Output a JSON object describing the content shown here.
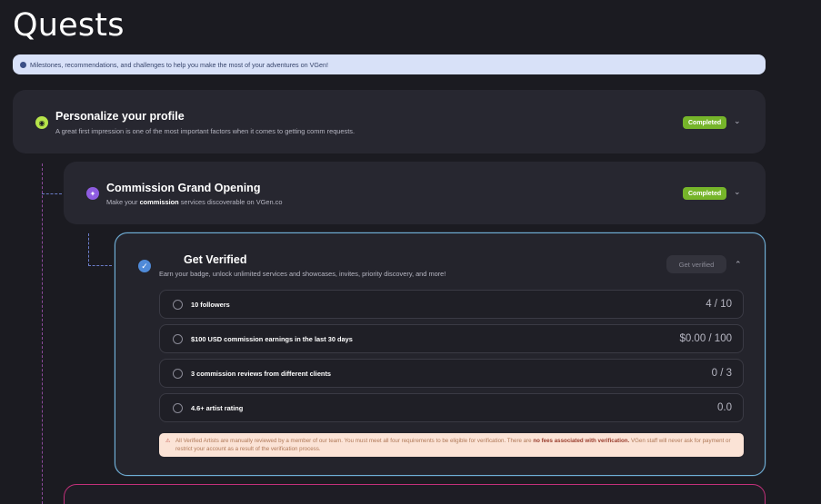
{
  "page": {
    "title": "Quests"
  },
  "banner": {
    "text": "Milestones, recommendations, and challenges to help you make the most of your adventures on VGen!"
  },
  "quests": {
    "personalize": {
      "title": "Personalize your profile",
      "description": "A great first impression is one of the most important factors when it comes to getting comm requests.",
      "status": "Completed"
    },
    "commission": {
      "title": "Commission Grand Opening",
      "description_pre": "Make your ",
      "description_bold": "commission",
      "description_post": " services discoverable on VGen.co",
      "status": "Completed"
    },
    "verified": {
      "title": "Get Verified",
      "description": "Earn your badge, unlock unlimited services and showcases, invites, priority discovery, and more!",
      "button_label": "Get verified",
      "requirements": [
        {
          "label": "10 followers",
          "value": "4 / 10"
        },
        {
          "label": "$100 USD commission earnings in the last 30 days",
          "value": "$0.00 / 100"
        },
        {
          "label": "3 commission reviews from different clients",
          "value": "0 / 3"
        },
        {
          "label": "4.6+ artist rating",
          "value": "0.0"
        }
      ],
      "notice_pre": "All Verified Artists are manually reviewed by a member of our team. You must meet all four requirements to be eligible for verification. There are ",
      "notice_bold": "no fees associated with verification.",
      "notice_post": " VGen staff will never ask for payment or restrict your account as a result of the verification process."
    }
  },
  "colors": {
    "completed_badge": "#76b52a",
    "verified_border": "#6fb0d6",
    "next_border": "#c2307a"
  }
}
